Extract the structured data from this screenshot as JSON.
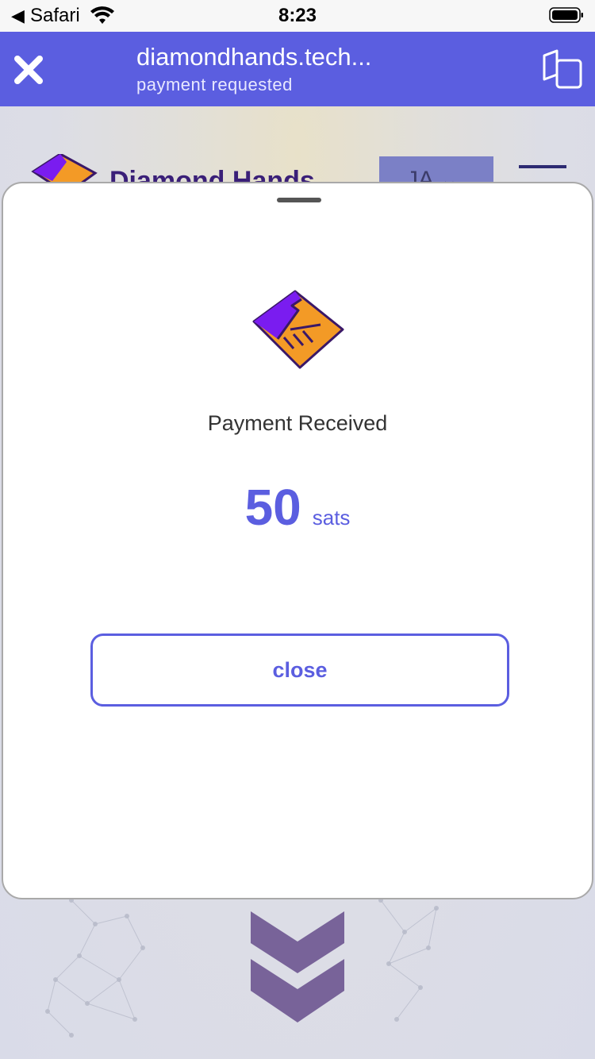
{
  "status_bar": {
    "back_app": "Safari",
    "time": "8:23"
  },
  "header": {
    "domain": "diamondhands.tech...",
    "status": "payment requested"
  },
  "background": {
    "brand": "Diamond Hands",
    "language": "JA"
  },
  "sheet": {
    "title": "Payment Received",
    "amount": "50",
    "unit": "sats",
    "close_label": "close"
  },
  "colors": {
    "accent": "#5b5ee0",
    "logo_purple": "#7a1cf0",
    "logo_orange": "#f39a26",
    "logo_outline": "#3a1868",
    "chevron": "#786399"
  },
  "icons": {
    "close": "close-icon",
    "copy": "copy-icon",
    "wifi": "wifi-icon",
    "battery": "battery-icon",
    "logo": "diamond-hands-logo"
  }
}
